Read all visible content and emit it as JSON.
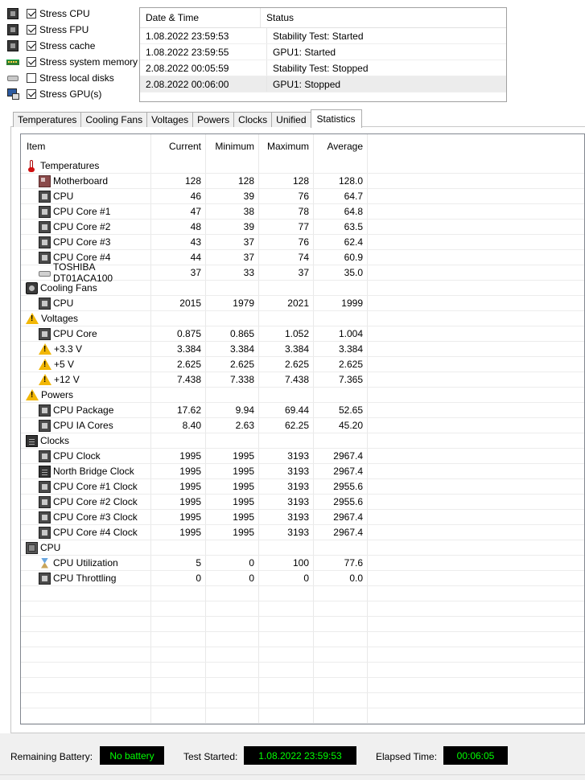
{
  "stress_options": [
    {
      "label": "Stress CPU",
      "checked": true,
      "icon": "cpu-chip-icon"
    },
    {
      "label": "Stress FPU",
      "checked": true,
      "icon": "fpu-chip-icon"
    },
    {
      "label": "Stress cache",
      "checked": true,
      "icon": "cache-chip-icon"
    },
    {
      "label": "Stress system memory",
      "checked": true,
      "icon": "memory-icon"
    },
    {
      "label": "Stress local disks",
      "checked": false,
      "icon": "disk-icon"
    },
    {
      "label": "Stress GPU(s)",
      "checked": true,
      "icon": "monitor-icon"
    }
  ],
  "log": {
    "headers": {
      "datetime": "Date & Time",
      "status": "Status"
    },
    "rows": [
      {
        "datetime": "1.08.2022 23:59:53",
        "status": "Stability Test: Started"
      },
      {
        "datetime": "1.08.2022 23:59:55",
        "status": "GPU1: Started"
      },
      {
        "datetime": "2.08.2022 00:05:59",
        "status": "Stability Test: Stopped"
      },
      {
        "datetime": "2.08.2022 00:06:00",
        "status": "GPU1: Stopped"
      }
    ]
  },
  "tabs": [
    "Temperatures",
    "Cooling Fans",
    "Voltages",
    "Powers",
    "Clocks",
    "Unified",
    "Statistics"
  ],
  "active_tab": "Statistics",
  "stats": {
    "headers": {
      "item": "Item",
      "current": "Current",
      "minimum": "Minimum",
      "maximum": "Maximum",
      "average": "Average"
    },
    "rows": [
      {
        "group": true,
        "name": "Temperatures",
        "icon": "thermometer-icon"
      },
      {
        "name": "Motherboard",
        "icon": "motherboard-icon",
        "cur": "128",
        "min": "128",
        "max": "128",
        "avg": "128.0"
      },
      {
        "name": "CPU",
        "icon": "cpu-chip-icon",
        "cur": "46",
        "min": "39",
        "max": "76",
        "avg": "64.7"
      },
      {
        "name": "CPU Core #1",
        "icon": "cpu-chip-icon",
        "cur": "47",
        "min": "38",
        "max": "78",
        "avg": "64.8"
      },
      {
        "name": "CPU Core #2",
        "icon": "cpu-chip-icon",
        "cur": "48",
        "min": "39",
        "max": "77",
        "avg": "63.5"
      },
      {
        "name": "CPU Core #3",
        "icon": "cpu-chip-icon",
        "cur": "43",
        "min": "37",
        "max": "76",
        "avg": "62.4"
      },
      {
        "name": "CPU Core #4",
        "icon": "cpu-chip-icon",
        "cur": "44",
        "min": "37",
        "max": "74",
        "avg": "60.9"
      },
      {
        "name": "TOSHIBA DT01ACA100",
        "icon": "disk-icon",
        "cur": "37",
        "min": "33",
        "max": "37",
        "avg": "35.0"
      },
      {
        "group": true,
        "name": "Cooling Fans",
        "icon": "fan-icon"
      },
      {
        "name": "CPU",
        "icon": "cpu-chip-icon",
        "cur": "2015",
        "min": "1979",
        "max": "2021",
        "avg": "1999"
      },
      {
        "group": true,
        "name": "Voltages",
        "icon": "warning-icon"
      },
      {
        "name": "CPU Core",
        "icon": "cpu-chip-icon",
        "cur": "0.875",
        "min": "0.865",
        "max": "1.052",
        "avg": "1.004"
      },
      {
        "name": "+3.3 V",
        "icon": "warning-icon",
        "cur": "3.384",
        "min": "3.384",
        "max": "3.384",
        "avg": "3.384"
      },
      {
        "name": "+5 V",
        "icon": "warning-icon",
        "cur": "2.625",
        "min": "2.625",
        "max": "2.625",
        "avg": "2.625"
      },
      {
        "name": "+12 V",
        "icon": "warning-icon",
        "cur": "7.438",
        "min": "7.338",
        "max": "7.438",
        "avg": "7.365"
      },
      {
        "group": true,
        "name": "Powers",
        "icon": "warning-icon"
      },
      {
        "name": "CPU Package",
        "icon": "cpu-chip-icon",
        "cur": "17.62",
        "min": "9.94",
        "max": "69.44",
        "avg": "52.65"
      },
      {
        "name": "CPU IA Cores",
        "icon": "cpu-chip-icon",
        "cur": "8.40",
        "min": "2.63",
        "max": "62.25",
        "avg": "45.20"
      },
      {
        "group": true,
        "name": "Clocks",
        "icon": "clock-chip-icon"
      },
      {
        "name": "CPU Clock",
        "icon": "cpu-chip-icon",
        "cur": "1995",
        "min": "1995",
        "max": "3193",
        "avg": "2967.4"
      },
      {
        "name": "North Bridge Clock",
        "icon": "clock-chip-icon",
        "cur": "1995",
        "min": "1995",
        "max": "3193",
        "avg": "2967.4"
      },
      {
        "name": "CPU Core #1 Clock",
        "icon": "cpu-chip-icon",
        "cur": "1995",
        "min": "1995",
        "max": "3193",
        "avg": "2955.6"
      },
      {
        "name": "CPU Core #2 Clock",
        "icon": "cpu-chip-icon",
        "cur": "1995",
        "min": "1995",
        "max": "3193",
        "avg": "2955.6"
      },
      {
        "name": "CPU Core #3 Clock",
        "icon": "cpu-chip-icon",
        "cur": "1995",
        "min": "1995",
        "max": "3193",
        "avg": "2967.4"
      },
      {
        "name": "CPU Core #4 Clock",
        "icon": "cpu-chip-icon",
        "cur": "1995",
        "min": "1995",
        "max": "3193",
        "avg": "2967.4"
      },
      {
        "group": true,
        "name": "CPU",
        "icon": "cpu-icon"
      },
      {
        "name": "CPU Utilization",
        "icon": "hourglass-icon",
        "cur": "5",
        "min": "0",
        "max": "100",
        "avg": "77.6"
      },
      {
        "name": "CPU Throttling",
        "icon": "cpu-chip-icon",
        "cur": "0",
        "min": "0",
        "max": "0",
        "avg": "0.0"
      }
    ]
  },
  "bottom": {
    "battery_label": "Remaining Battery:",
    "battery_value": "No battery",
    "started_label": "Test Started:",
    "started_value": "1.08.2022 23:59:53",
    "elapsed_label": "Elapsed Time:",
    "elapsed_value": "00:06:05"
  },
  "colors": {
    "lcd_background": "#000000",
    "lcd_text": "#00ff00",
    "selected_row": "#ececec"
  }
}
